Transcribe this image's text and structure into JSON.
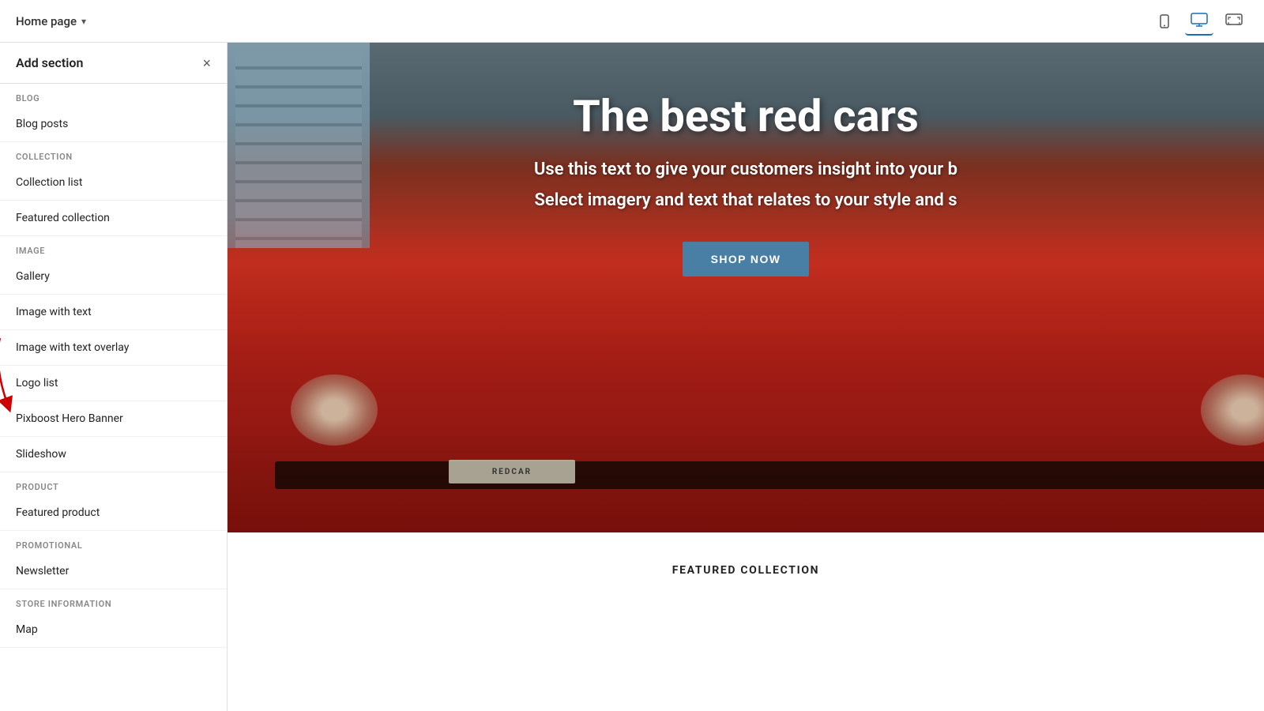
{
  "topbar": {
    "page_title": "Home page",
    "chevron": "▾",
    "devices": [
      {
        "id": "mobile",
        "icon": "📱",
        "label": "mobile-icon"
      },
      {
        "id": "desktop",
        "label": "desktop-icon",
        "active": true
      },
      {
        "id": "fullscreen",
        "label": "fullscreen-icon"
      }
    ]
  },
  "sidebar": {
    "title": "Add section",
    "close_label": "×",
    "categories": [
      {
        "id": "blog",
        "label": "BLOG",
        "items": [
          {
            "id": "blog-posts",
            "label": "Blog posts"
          }
        ]
      },
      {
        "id": "collection",
        "label": "COLLECTION",
        "items": [
          {
            "id": "collection-list",
            "label": "Collection list"
          },
          {
            "id": "featured-collection",
            "label": "Featured collection"
          }
        ]
      },
      {
        "id": "image",
        "label": "IMAGE",
        "items": [
          {
            "id": "gallery",
            "label": "Gallery"
          },
          {
            "id": "image-with-text",
            "label": "Image with text"
          },
          {
            "id": "image-with-text-overlay",
            "label": "Image with text overlay"
          },
          {
            "id": "logo-list",
            "label": "Logo list"
          },
          {
            "id": "pixboost-hero-banner",
            "label": "Pixboost Hero Banner",
            "annotated": true
          }
        ]
      },
      {
        "id": "slideshow-cat",
        "label": "",
        "items": [
          {
            "id": "slideshow",
            "label": "Slideshow"
          }
        ]
      },
      {
        "id": "product",
        "label": "PRODUCT",
        "items": [
          {
            "id": "featured-product",
            "label": "Featured product"
          }
        ]
      },
      {
        "id": "promotional",
        "label": "PROMOTIONAL",
        "items": [
          {
            "id": "newsletter",
            "label": "Newsletter"
          }
        ]
      },
      {
        "id": "store-info",
        "label": "STORE INFORMATION",
        "items": [
          {
            "id": "map",
            "label": "Map"
          }
        ]
      }
    ]
  },
  "hero": {
    "title": "The best red cars",
    "subtitle_line1": "Use this text to give your customers insight into your b",
    "subtitle_line2": "Select imagery and text that relates to your style and s",
    "cta_label": "SHOP NOW"
  },
  "featured_collection": {
    "title": "FEATURED COLLECTION"
  },
  "colors": {
    "accent_blue": "#1a6eb5",
    "cta_blue": "#4a7fa5",
    "category_text": "#888888",
    "sidebar_border": "#e0e0e0"
  }
}
